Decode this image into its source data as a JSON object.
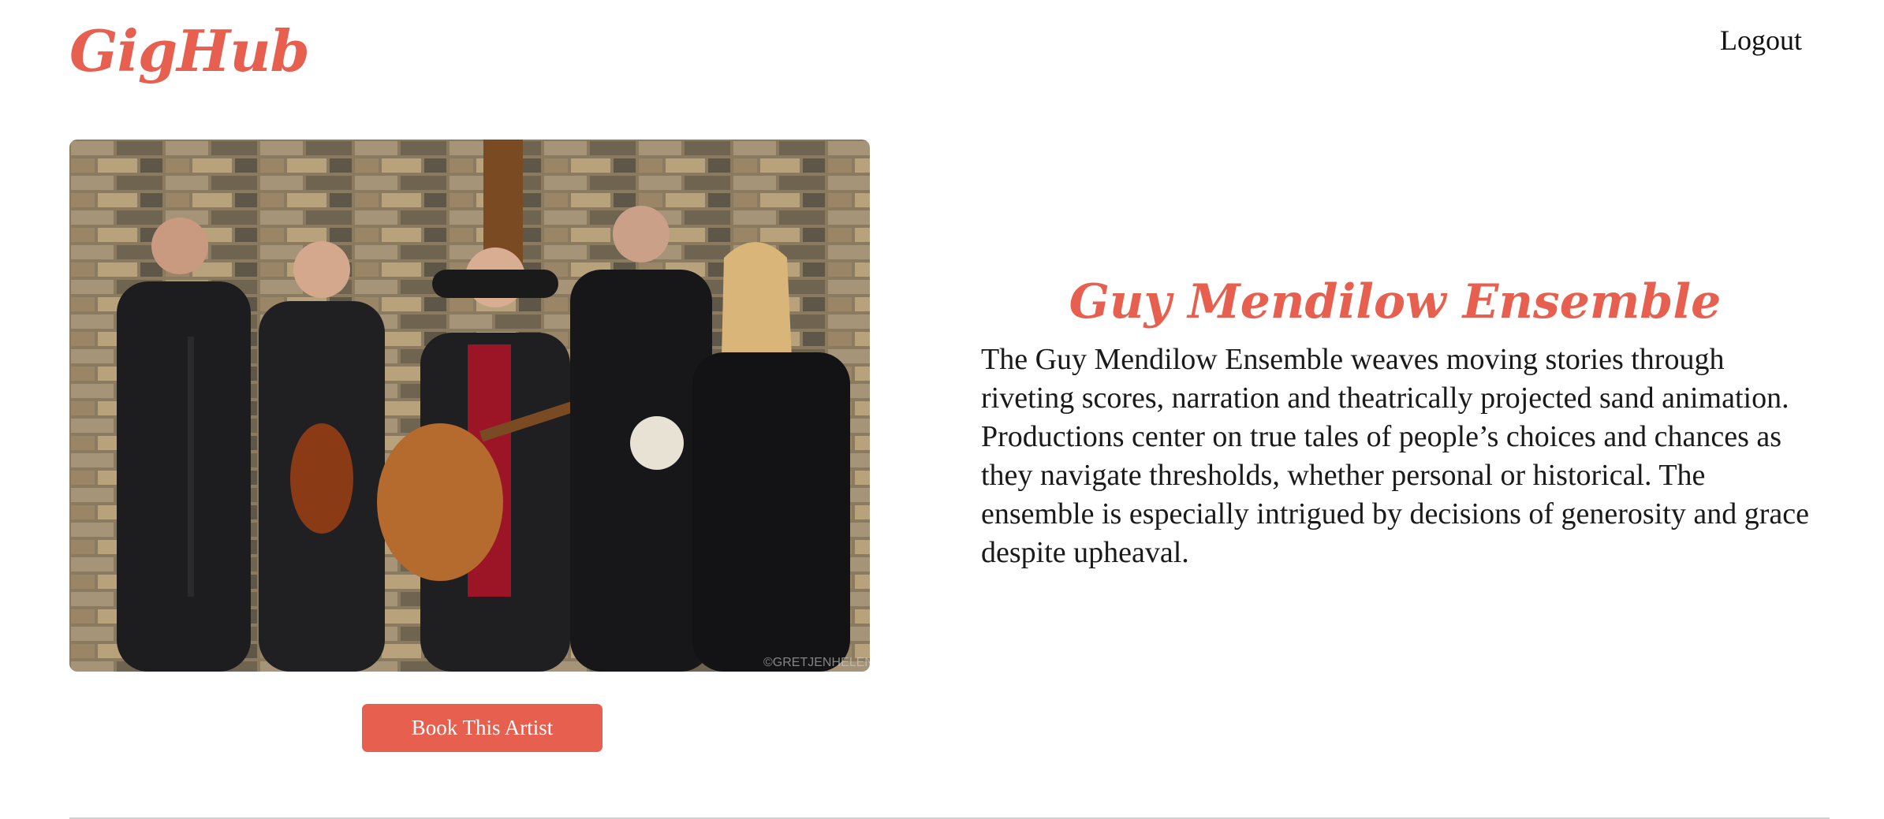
{
  "header": {
    "logo": "GigHub",
    "logout_label": "Logout"
  },
  "artist": {
    "name": "Guy Mendilow Ensemble",
    "bio": "The Guy Mendilow Ensemble weaves moving stories through riveting scores, narration and theatrically projected sand animation. Productions center on true tales of people’s choices and chances as they navigate thresholds, whether personal or historical. The ensemble is especially intrigued by decisions of generosity and grace despite upheaval.",
    "photo_alt": "Guy Mendilow Ensemble band photo",
    "book_label": "Book This Artist"
  },
  "colors": {
    "accent": "#e65f4f",
    "text": "#1a1a1a",
    "divider": "#d0d0d0"
  }
}
